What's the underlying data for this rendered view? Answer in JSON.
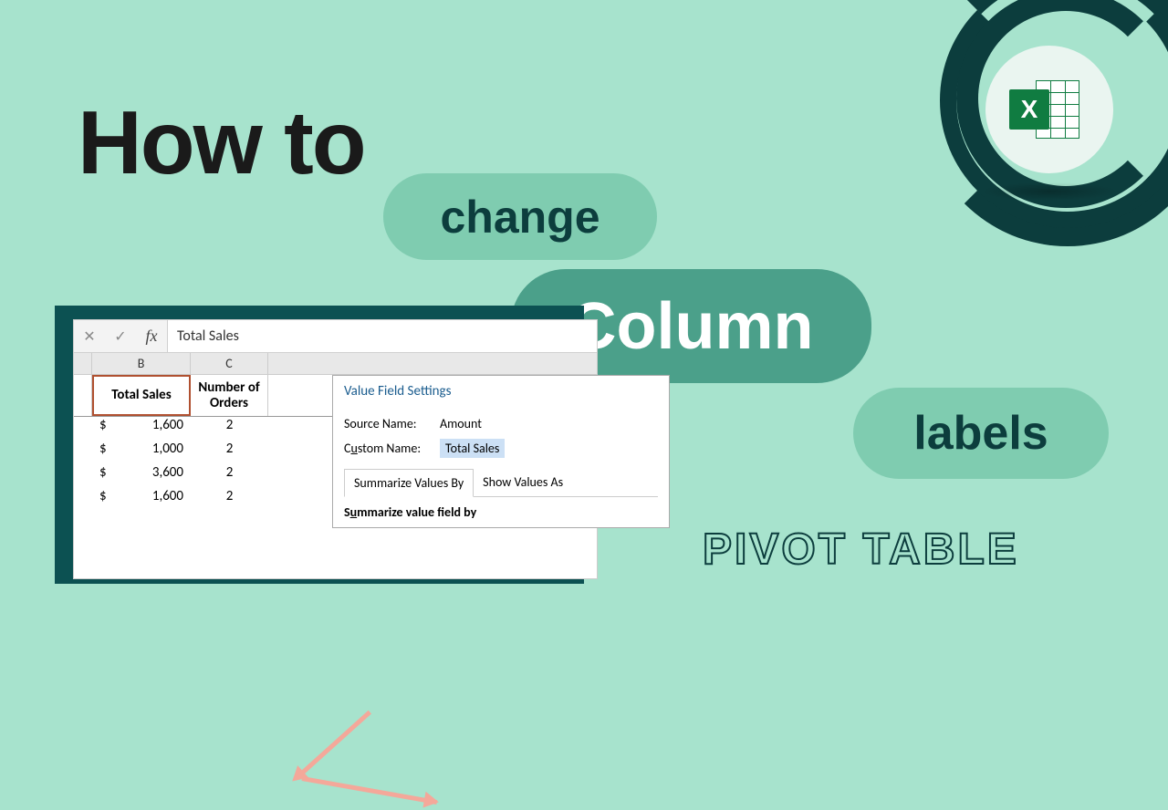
{
  "title": {
    "main": "How to",
    "change": "change",
    "column": "Column",
    "labels": "labels",
    "pivot": "PIVOT TABLE"
  },
  "formula_bar": {
    "fx": "fx",
    "value": "Total Sales"
  },
  "columns": {
    "b": "B",
    "c": "C"
  },
  "headers": {
    "total_sales": "Total Sales",
    "orders": "Number of Orders"
  },
  "rows": [
    {
      "dollar": "$",
      "amount": "1,600",
      "count": "2"
    },
    {
      "dollar": "$",
      "amount": "1,000",
      "count": "2"
    },
    {
      "dollar": "$",
      "amount": "3,600",
      "count": "2"
    },
    {
      "dollar": "$",
      "amount": "1,600",
      "count": "2"
    }
  ],
  "dialog": {
    "title": "Value Field Settings",
    "source_label": "Source Name:",
    "source_value": "Amount",
    "custom_label_pre": "C",
    "custom_label_mid": "u",
    "custom_label_post": "stom Name:",
    "custom_value": "Total Sales",
    "tab1": "Summarize Values By",
    "tab2": "Show Values As",
    "summ_pre": "S",
    "summ_mid": "u",
    "summ_post": "mmarize value field by"
  },
  "logo": {
    "x": "X"
  }
}
